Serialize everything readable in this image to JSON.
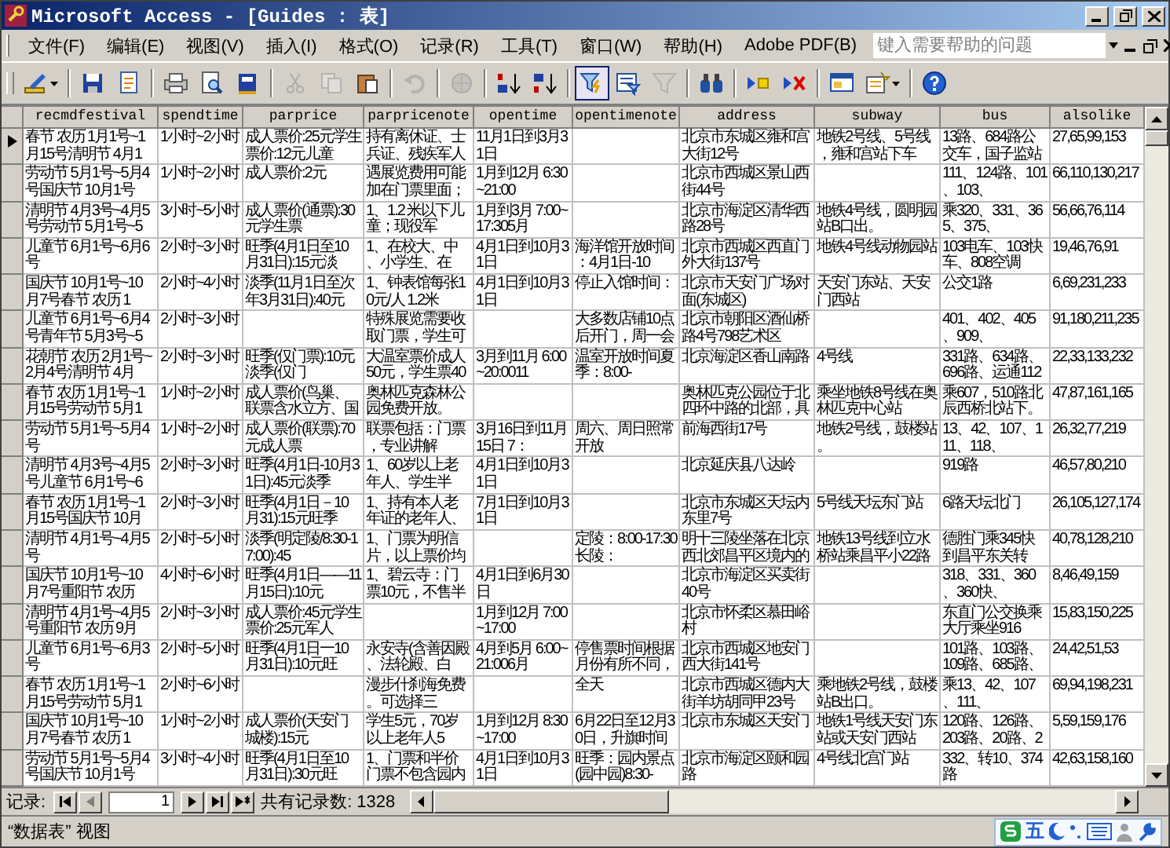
{
  "window": {
    "title": "Microsoft Access - [Guides : 表]"
  },
  "menu": [
    "文件(F)",
    "编辑(E)",
    "视图(V)",
    "插入(I)",
    "格式(O)",
    "记录(R)",
    "工具(T)",
    "窗口(W)",
    "帮助(H)",
    "Adobe PDF(B)"
  ],
  "help_search": {
    "placeholder": "键入需要帮助的问题"
  },
  "toolbar": [
    {
      "kind": "dropdown",
      "pressed": false,
      "disabled": false
    },
    {
      "kind": "separator"
    },
    {
      "kind": "button",
      "pressed": false,
      "disabled": false
    },
    {
      "kind": "button",
      "pressed": false,
      "disabled": false
    },
    {
      "kind": "separator"
    },
    {
      "kind": "button",
      "pressed": false,
      "disabled": false
    },
    {
      "kind": "button",
      "pressed": false,
      "disabled": false
    },
    {
      "kind": "button",
      "pressed": false,
      "disabled": false
    },
    {
      "kind": "separator"
    },
    {
      "kind": "button",
      "pressed": false,
      "disabled": true
    },
    {
      "kind": "button",
      "pressed": false,
      "disabled": true
    },
    {
      "kind": "button",
      "pressed": false,
      "disabled": false
    },
    {
      "kind": "separator"
    },
    {
      "kind": "button",
      "pressed": false,
      "disabled": true
    },
    {
      "kind": "separator"
    },
    {
      "kind": "button",
      "pressed": false,
      "disabled": true
    },
    {
      "kind": "separator"
    },
    {
      "kind": "button",
      "pressed": false,
      "disabled": false
    },
    {
      "kind": "button",
      "pressed": false,
      "disabled": false
    },
    {
      "kind": "separator"
    },
    {
      "kind": "button",
      "pressed": true,
      "disabled": false
    },
    {
      "kind": "button",
      "pressed": false,
      "disabled": false
    },
    {
      "kind": "button",
      "pressed": false,
      "disabled": true
    },
    {
      "kind": "separator"
    },
    {
      "kind": "button",
      "pressed": false,
      "disabled": false
    },
    {
      "kind": "separator"
    },
    {
      "kind": "button",
      "pressed": false,
      "disabled": false
    },
    {
      "kind": "button",
      "pressed": false,
      "disabled": false
    },
    {
      "kind": "separator"
    },
    {
      "kind": "button",
      "pressed": false,
      "disabled": false
    },
    {
      "kind": "dropdown",
      "pressed": false,
      "disabled": false
    },
    {
      "kind": "separator"
    },
    {
      "kind": "button",
      "pressed": false,
      "disabled": false
    }
  ],
  "table": {
    "columns": [
      "recmdfestival",
      "spendtime",
      "parprice",
      "parpricenote",
      "opentime",
      "opentimenote",
      "address",
      "subway",
      "bus",
      "alsolike"
    ],
    "rows": [
      {
        "current": true,
        "cells": {
          "recmdfestival": "春节 农历 1月1号~1月15号清明节 4月1",
          "spendtime": "1小时~2小时",
          "parprice": "成人票价:25元学生票价:12元儿童",
          "parpricenote": "持有离休证、士兵证、残疾军人",
          "opentime": "11月1日到3月31日",
          "address": "北京市东城区雍和宫大街12号",
          "subway": "地铁2号线、5号线，雍和宫站下车",
          "bus": "13路、684路公交车，国子监站",
          "alsolike": "27,65,99,153"
        }
      },
      {
        "current": false,
        "cells": {
          "recmdfestival": "劳动节 5月1号~5月4号国庆节 10月1号",
          "spendtime": "1小时~2小时",
          "parprice": "成人票价:2元",
          "parpricenote": "遇展览费用可能加在门票里面；",
          "opentime": "1月到12月 6:30~21:00",
          "address": "北京市西城区景山西街44号",
          "bus": "111、124路、101、103、",
          "alsolike": "66,110,130,217"
        }
      },
      {
        "current": false,
        "cells": {
          "recmdfestival": "清明节 4月3号~4月5号劳动节 5月1号~5",
          "spendtime": "3小时~5小时",
          "parprice": "成人票价(通票):30元学生票",
          "parpricenote": "1、1.2 米以下儿童；现役军",
          "opentime": "1月到3月 7:00~17:305月",
          "address": "北京市海淀区清华西路28号",
          "subway": "地铁4号线，圆明园站B口出。",
          "bus": "乘320、331、365、375、",
          "alsolike": "56,66,76,114"
        }
      },
      {
        "current": false,
        "cells": {
          "recmdfestival": "儿童节 6月1号~6月6号",
          "spendtime": "2小时~3小时",
          "parprice": "旺季(4月1日至10月31日):15元淡",
          "parpricenote": "1、在校大、中、小学生、在",
          "opentime": "4月1日到10月31日",
          "opentimenote": "海洋馆开放时间：4月1日-10",
          "address": "北京市西城区西直门外大街137号",
          "subway": "地铁4号线动物园站",
          "bus": "103电车、103快车、808空调",
          "alsolike": "19,46,76,91"
        }
      },
      {
        "current": false,
        "cells": {
          "recmdfestival": "国庆节 10月1号~10月7号春节 农历 1",
          "spendtime": "2小时~4小时",
          "parprice": "淡季(11月1日至次年3月31日):40元",
          "parpricenote": "1、钟表馆每张10元/人 1.2米",
          "opentime": "4月1日到10月31日",
          "opentimenote": "停止入馆时间：",
          "address": "北京市天安门广场对面(东城区)",
          "subway": "天安门东站、天安门西站",
          "bus": "公交1路",
          "alsolike": "6,69,231,233"
        }
      },
      {
        "current": false,
        "cells": {
          "recmdfestival": "儿童节 6月1号~6月4号青年节 5月3号~5",
          "spendtime": "2小时~3小时",
          "parpricenote": "特殊展览需要收取门票，学生可",
          "opentimenote": "大多数店铺10点后开门，周一会",
          "address": "北京市朝阳区酒仙桥路4号798艺术区",
          "bus": "401、402、405、909、",
          "alsolike": "91,180,211,235"
        }
      },
      {
        "current": false,
        "cells": {
          "recmdfestival": "花朝节 农历 2月1号~2月4号清明节 4月",
          "spendtime": "2小时~3小时",
          "parprice": "旺季(仅门票):10元淡季(仅门",
          "parpricenote": "大温室票价成人50元，学生票40",
          "opentime": "3月到11月 6:00~20:0011",
          "opentimenote": "温室开放时间夏季：8:00-",
          "address": "北京海淀区香山南路",
          "subway": "4号线",
          "bus": "331路、634路、696路、运通112",
          "alsolike": "22,33,133,232"
        }
      },
      {
        "current": false,
        "cells": {
          "recmdfestival": "春节 农历 1月1号~1月15号劳动节 5月1",
          "spendtime": "1小时~2小时",
          "parprice": "成人票价(鸟巢、联票含水立方、国",
          "parpricenote": "奥林匹克森林公园免费开放。",
          "address": "奥林匹克公园位于北四环中路的北部，具",
          "subway": "乘坐地铁8号线在奥林匹克中心站",
          "bus": "乘607，510路北辰西桥北站下。",
          "alsolike": "47,87,161,165"
        }
      },
      {
        "current": false,
        "cells": {
          "recmdfestival": "劳动节 5月1号~5月4号",
          "spendtime": "1小时~2小时",
          "parprice": "成人票价(联票):70元成人票",
          "parpricenote": "联票包括：门票，专业讲解",
          "opentime": "3月16日到11月15日 7：",
          "opentimenote": "周六、周日照常开放",
          "address": "前海西街17号",
          "subway": "地铁2号线，鼓楼站。",
          "bus": "13、42、107、111、118、",
          "alsolike": "26,32,77,219"
        }
      },
      {
        "current": false,
        "cells": {
          "recmdfestival": "清明节 4月3号~4月5号儿童节 6月1号~6",
          "spendtime": "2小时~3小时",
          "parprice": "旺季(4月1日-10月31日):45元淡季",
          "parpricenote": "1、60岁以上老年人、学生半",
          "opentime": "4月1日到10月31日",
          "address": "北京延庆县八达岭",
          "bus": "919路",
          "alsolike": "46,57,80,210"
        }
      },
      {
        "current": false,
        "cells": {
          "recmdfestival": "春节 农历 1月1号~1月15号国庆节 10月",
          "spendtime": "2小时~3小时",
          "parprice": "旺季(4月1日－10月31):15元旺季",
          "parpricenote": "1、持有本人老年证的老年人、",
          "opentime": "7月1日到10月31日",
          "address": "北京市东城区天坛内东里7号",
          "subway": "5号线天坛东门站",
          "bus": "6路天坛北门",
          "alsolike": "26,105,127,174"
        }
      },
      {
        "current": false,
        "cells": {
          "recmdfestival": "清明节 4月1号~4月5号",
          "spendtime": "2小时~5小时",
          "parprice": "淡季(明定陵/8:30-17:00):45",
          "parpricenote": "1、门票为明信片，以上票价均",
          "opentimenote": "定陵：8:00-17:30长陵：",
          "address": "明十三陵坐落在北京西北郊昌平区境内的",
          "subway": "地铁13号线到立水桥站乘昌平小22路",
          "bus": "德胜门乘345快到昌平东关转",
          "alsolike": "40,78,128,210"
        }
      },
      {
        "current": false,
        "cells": {
          "recmdfestival": "国庆节 10月1号~10月7号重阳节 农历",
          "spendtime": "4小时~6小时",
          "parprice": "旺季(4月1日——11月15日):10元",
          "parpricenote": "1、碧云寺：门票10元，不售半",
          "opentime": "4月1日到6月30日",
          "address": "北京市海淀区买卖街40号",
          "bus": "318、331、360、360快、",
          "alsolike": "8,46,49,159"
        }
      },
      {
        "current": false,
        "cells": {
          "recmdfestival": "清明节 4月1号~4月5号重阳节 农历 9月",
          "spendtime": "2小时~3小时",
          "parprice": "成人票价:45元学生票价:25元军人",
          "opentime": "1月到12月 7:00~17:00",
          "address": "北京市怀柔区慕田峪村",
          "bus": "东直门公交换乘大厅乘坐916",
          "alsolike": "15,83,150,225"
        }
      },
      {
        "current": false,
        "cells": {
          "recmdfestival": "儿童节 6月1号~6月3号",
          "spendtime": "2小时~5小时",
          "parprice": "旺季(4月1日一10月31日):10元旺",
          "parpricenote": "永安寺(含善因殿、法轮殿、白",
          "opentime": "4月到5月 6:00~21:006月",
          "opentimenote": "停售票时间根据月份有所不同，",
          "address": "北京市西城区地安门西大街141号",
          "bus": "101路、103路、109路、685路、",
          "alsolike": "24,42,51,53"
        }
      },
      {
        "current": false,
        "cells": {
          "recmdfestival": "春节 农历 1月1号~1月15号劳动节 5月1",
          "spendtime": "2小时~6小时",
          "parpricenote": "漫步什刹海免费。可选择三",
          "opentimenote": "全天",
          "address": "北京市西城区德内大街羊坊胡同甲23号",
          "subway": "乘地铁2号线，鼓楼站B出口。",
          "bus": "乘13、42、107、111、",
          "alsolike": "69,94,198,231"
        }
      },
      {
        "current": false,
        "cells": {
          "recmdfestival": "国庆节 10月1号~10月7号春节 农历 1",
          "spendtime": "1小时~2小时",
          "parprice": "成人票价(天安门城楼):15元",
          "parpricenote": "学生5元，70岁以上老年人5",
          "opentime": "1月到12月 8:30~17:00",
          "opentimenote": "6月22日至12月30日，升旗时间",
          "address": "北京市东城区天安门",
          "subway": "地铁1号线天安门东站或天安门西站",
          "bus": "120路、126路、203路、20路、2",
          "alsolike": "5,59,159,176"
        }
      },
      {
        "current": false,
        "cells": {
          "recmdfestival": "劳动节 5月1号~5月4号国庆节 10月1号",
          "spendtime": "3小时~4小时",
          "parprice": "旺季(4月1日至10月31日):30元旺",
          "parpricenote": "1、门票和半价门票不包含园内",
          "opentime": "4月1日到10月31日",
          "opentimenote": "旺季：园内景点(园中园)8:30-",
          "address": "北京市海淀区颐和园路",
          "subway": "4号线北宫门站",
          "bus": "332、转10、374路",
          "alsolike": "42,63,158,160"
        }
      }
    ]
  },
  "navigator": {
    "label": "记录:",
    "record": "1",
    "count": "共有记录数: 1328"
  },
  "status_bar": {
    "text": "“数据表” 视图",
    "ime_mode": "五"
  }
}
